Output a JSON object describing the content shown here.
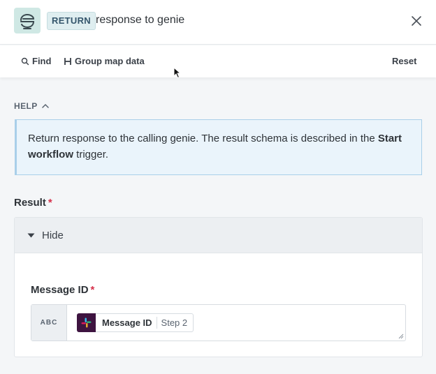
{
  "header": {
    "badge": "RETURN",
    "title": "response to genie",
    "logo_icon": "genie-logo-icon",
    "close_icon": "close-icon"
  },
  "toolbar": {
    "find_label": "Find",
    "group_label": "Group map data",
    "reset_label": "Reset"
  },
  "help": {
    "toggle_label": "HELP",
    "text_before": "Return response to the calling genie. The result schema is described in the ",
    "text_bold": "Start workflow",
    "text_after": " trigger."
  },
  "result": {
    "label": "Result",
    "required_mark": "*",
    "hide_label": "Hide",
    "field": {
      "label": "Message ID",
      "required_mark": "*",
      "type_tag": "ABC",
      "pill_name": "Message ID",
      "pill_step": "Step 2",
      "pill_icon": "slack-icon"
    }
  },
  "colors": {
    "accent_help_bg": "#eaf4fb",
    "accent_help_border": "#a9cfe9",
    "required": "#d6304a",
    "slack_bg": "#3e1440"
  }
}
